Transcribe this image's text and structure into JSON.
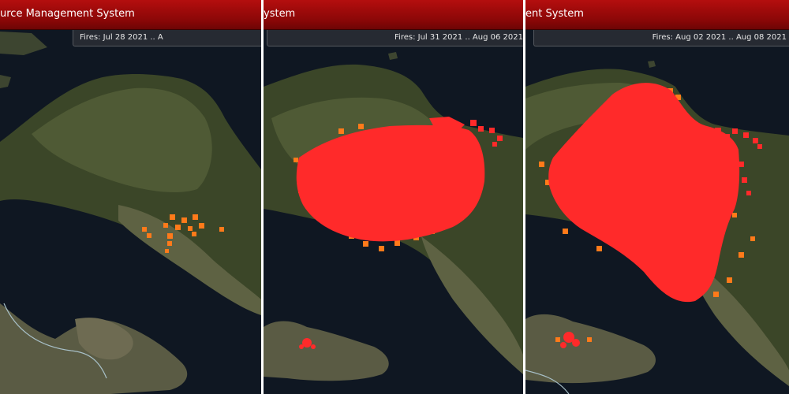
{
  "colors": {
    "sea": "#0f1722",
    "land_dark": "#2f3a22",
    "land_mid": "#4a5233",
    "land_light": "#6b6a4e",
    "fire_active": "#ff2a2a",
    "fire_older": "#ff7a1a",
    "title_bar": "#8a0707"
  },
  "panels": [
    {
      "title": "urce Management System",
      "date_range": "Fires: Jul 28 2021 .. A"
    },
    {
      "title": "ystem",
      "date_range": "Fires: Jul 31 2021 .. Aug 06 2021"
    },
    {
      "title": "ent System",
      "date_range": "Fires: Aug 02 2021 .. Aug 08 2021"
    }
  ]
}
